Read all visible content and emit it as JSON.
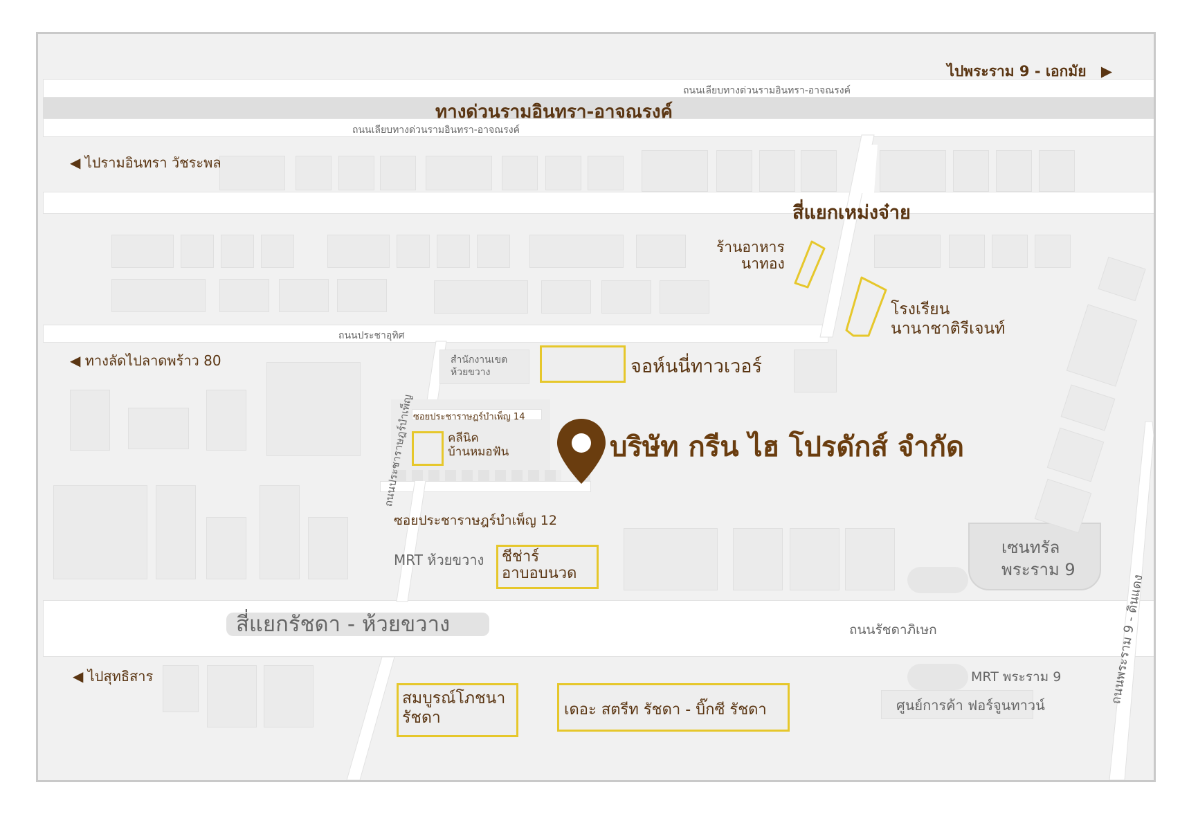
{
  "colors": {
    "brand": "#6a3d0f",
    "text": "#5a3512",
    "highlight": "#e6c72b",
    "road": "#ffffff",
    "ground": "#f1f1f1"
  },
  "icons": {
    "pin": "location-pin-icon",
    "arrow_left": "triangle-left-icon",
    "arrow_right": "triangle-right-icon"
  },
  "map": {
    "company": "บริษัท กรีน ไฮ โปรดักส์ จำกัด",
    "directions": {
      "to_rama9_ekkamai": "ไปพระราม 9 - เอกมัย",
      "to_ramintra_watcharapol": "ไปรามอินทรา วัชระพล",
      "to_shortcut_ladprao80": "ทางลัดไปลาดพร้าว 80",
      "to_suthisan": "ไปสุทธิสาร"
    },
    "roads": {
      "expressway": "ทางด่วนรามอินทรา-อาจณรงค์",
      "frontage_top": "ถนนเลียบทางด่วนรามอินทรา-อาจณรงค์",
      "frontage_bottom": "ถนนเลียบทางด่วนรามอินทรา-อาจณรงค์",
      "pracha_uthit": "ถนนประชาอุทิศ",
      "pracharat_bamphen": "ถนนประชาราษฎร์บำเพ็ญ",
      "soi14": "ซอยประชาราษฎร์บำเพ็ญ 14",
      "soi12": "ซอยประชาราษฎร์บำเพ็ญ 12",
      "ratchadaphisek": "ถนนรัชดาภิเษก",
      "rama9_dindaeng": "ถนนพระราม 9 - ดินแดง"
    },
    "intersections": {
      "mengjai": "สี่แยกเหม่งจ๋าย",
      "ratchada_huaikhwang": "สี่แยกรัชดา - ห้วยขวาง"
    },
    "landmarks": {
      "natong_line1": "ร้านอาหาร",
      "natong_line2": "นาทอง",
      "regent_line1": "โรงเรียน",
      "regent_line2": "นานาชาติรีเจนท์",
      "district_line1": "สำนักงานเขต",
      "district_line2": "ห้วยขวาง",
      "johnny_tower": "จอห์นนี่ทาวเวอร์",
      "clinic_line1": "คลีนิค",
      "clinic_line2": "บ้านหมอฟัน",
      "mrt_huaikhwang": "MRT ห้วยขวาง",
      "chiza_line1": "ชีช่าร์",
      "chiza_line2": "อาบอบนวด",
      "central_line1": "เซนทรัล",
      "central_line2": "พระราม 9",
      "mrt_rama9": "MRT พระราม 9",
      "fortune_town": "ศูนย์การค้า ฟอร์จูนทาวน์",
      "somboon_line1": "สมบูรณ์โภชนา",
      "somboon_line2": "รัชดา",
      "the_street": "เดอะ สตรีท รัชดา - บิ๊กซี รัชดา"
    }
  }
}
